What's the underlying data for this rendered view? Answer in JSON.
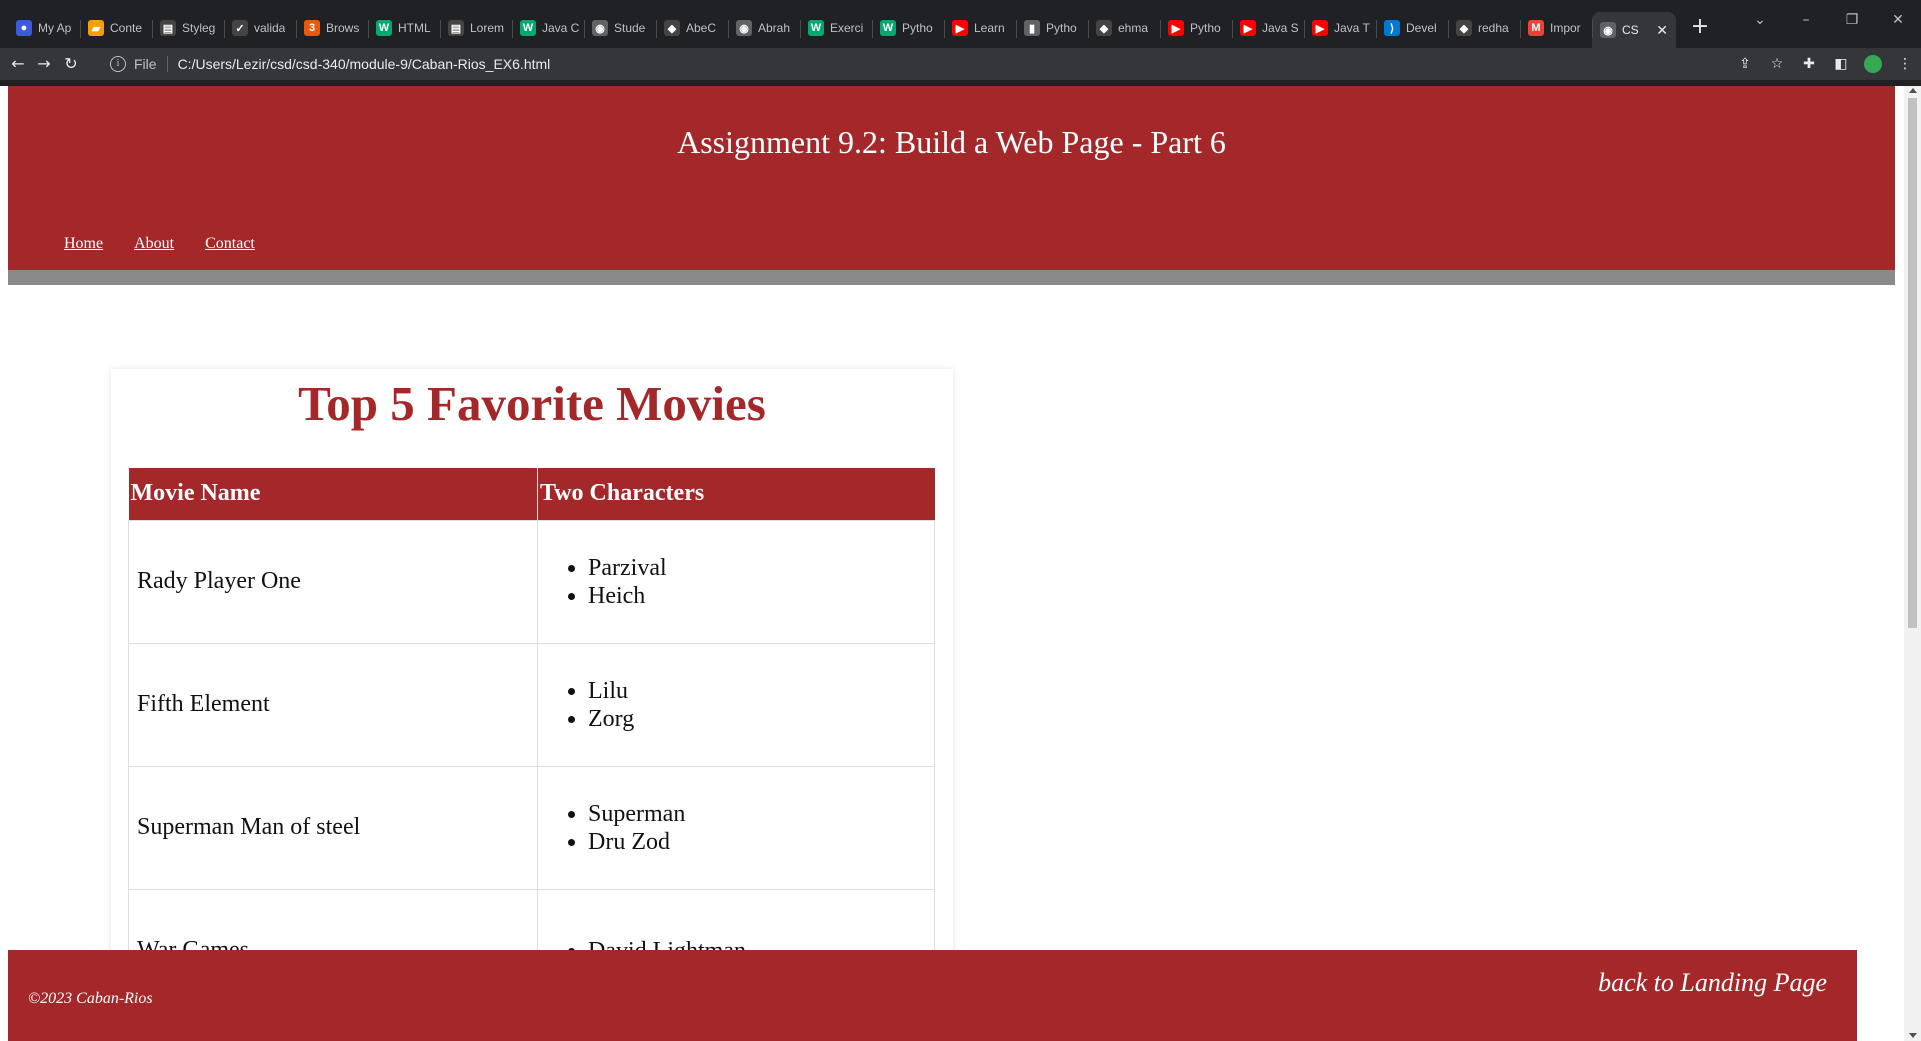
{
  "browser": {
    "tabs": [
      {
        "title": "My Ap",
        "icon": "circle-badge-icon",
        "color": "#3b5bdb"
      },
      {
        "title": "Conte",
        "icon": "canvas-icon",
        "color": "#f59f00"
      },
      {
        "title": "Styleg",
        "icon": "document-icon",
        "color": "#444444"
      },
      {
        "title": "valida",
        "icon": "validator-icon",
        "color": "#444444"
      },
      {
        "title": "Brows",
        "icon": "w3-icon",
        "color": "#e8590c"
      },
      {
        "title": "HTML",
        "icon": "w3schools-icon",
        "color": "#04aa6d"
      },
      {
        "title": "Lorem",
        "icon": "document-icon",
        "color": "#444444"
      },
      {
        "title": "Java C",
        "icon": "w3schools-icon",
        "color": "#04aa6d"
      },
      {
        "title": "Stude",
        "icon": "globe-icon",
        "color": "#5f6368"
      },
      {
        "title": "AbeC",
        "icon": "github-icon",
        "color": "#444444"
      },
      {
        "title": "Abrah",
        "icon": "globe-icon",
        "color": "#5f6368"
      },
      {
        "title": "Exerci",
        "icon": "w3schools-icon",
        "color": "#04aa6d"
      },
      {
        "title": "Pytho",
        "icon": "w3schools-icon",
        "color": "#04aa6d"
      },
      {
        "title": "Learn",
        "icon": "youtube-icon",
        "color": "#ff0000"
      },
      {
        "title": "Pytho",
        "icon": "bookmark-icon",
        "color": "#5f6368"
      },
      {
        "title": "ehma",
        "icon": "github-icon",
        "color": "#444444"
      },
      {
        "title": "Pytho",
        "icon": "youtube-icon",
        "color": "#ff0000"
      },
      {
        "title": "Java S",
        "icon": "youtube-icon",
        "color": "#ff0000"
      },
      {
        "title": "Java T",
        "icon": "youtube-icon",
        "color": "#ff0000"
      },
      {
        "title": "Devel",
        "icon": "vscode-icon",
        "color": "#0078d4"
      },
      {
        "title": "redha",
        "icon": "github-icon",
        "color": "#444444"
      },
      {
        "title": "Impor",
        "icon": "gmail-icon",
        "color": "#ea4335"
      }
    ],
    "active_tab": {
      "title": "CS",
      "icon": "globe-icon"
    },
    "address": {
      "scheme": "File",
      "url": "C:/Users/Lezir/csd/csd-340/module-9/Caban-Rios_EX6.html"
    }
  },
  "page": {
    "site_title": "Assignment 9.2: Build a Web Page - Part 6",
    "nav": [
      "Home",
      "About",
      "Contact"
    ],
    "movies_heading": "Top 5 Favorite Movies",
    "table": {
      "headers": [
        "Movie Name",
        "Two Characters"
      ],
      "rows": [
        {
          "movie": "Rady Player One",
          "characters": [
            "Parzival",
            "Heich"
          ]
        },
        {
          "movie": "Fifth Element",
          "characters": [
            "Lilu",
            "Zorg"
          ]
        },
        {
          "movie": "Superman Man of steel",
          "characters": [
            "Superman",
            "Dru Zod"
          ]
        },
        {
          "movie": "War Games",
          "characters": [
            "David Lightman"
          ]
        }
      ]
    },
    "footer": {
      "copyright": "©2023 Caban-Rios",
      "back_link": "back to Landing Page"
    }
  },
  "colors": {
    "brand_red": "#a4282a",
    "header_bar_gray": "#8a8a8a"
  }
}
